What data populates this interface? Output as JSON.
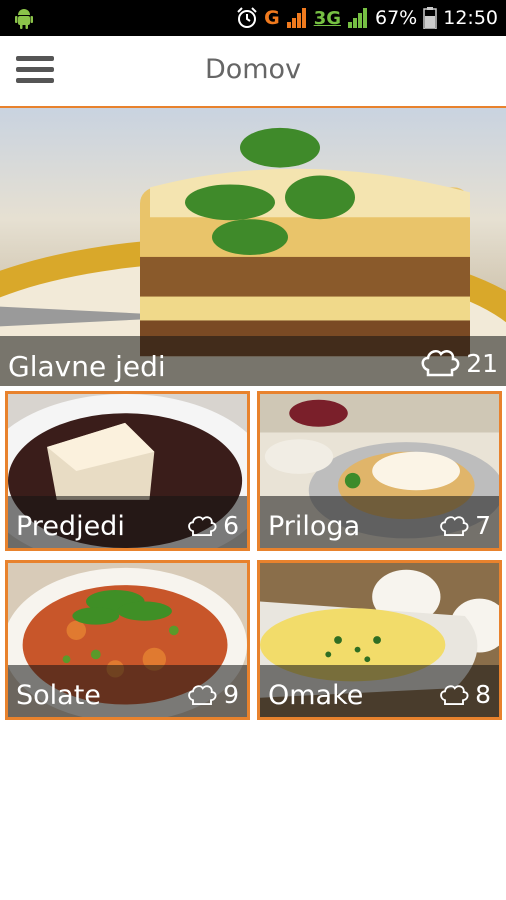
{
  "status_bar": {
    "network_g": "G",
    "network_3g": "3G",
    "battery": "67%",
    "time": "12:50",
    "icons": [
      "android-icon",
      "alarm-clock-icon",
      "signal-bars-icon",
      "battery-icon"
    ]
  },
  "action_bar": {
    "title": "Domov",
    "menu_icon": "hamburger-menu-icon"
  },
  "categories": [
    {
      "label": "Glavne jedi",
      "count": "21",
      "icon": "chef-hat-icon"
    },
    {
      "label": "Predjedi",
      "count": "6",
      "icon": "chef-hat-icon"
    },
    {
      "label": "Priloga",
      "count": "7",
      "icon": "chef-hat-icon"
    },
    {
      "label": "Solate",
      "count": "9",
      "icon": "chef-hat-icon"
    },
    {
      "label": "Omake",
      "count": "8",
      "icon": "chef-hat-icon"
    }
  ],
  "colors": {
    "tile_border": "#e8822d",
    "status_bar_bg": "#000000",
    "title_text": "#666666"
  }
}
